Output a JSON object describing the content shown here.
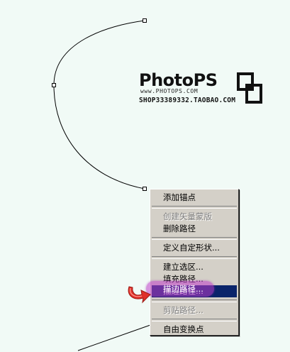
{
  "logo": {
    "brand": "PhotoPS",
    "url": "www.PHOTOPS.COM",
    "shop": "SHOP33389332.TAOBAO.COM"
  },
  "context_menu": {
    "items": [
      {
        "label": "添加锚点",
        "enabled": true
      },
      {
        "separator": true
      },
      {
        "label": "创建矢量蒙版",
        "enabled": false
      },
      {
        "label": "删除路径",
        "enabled": true
      },
      {
        "separator": true
      },
      {
        "label": "定义自定形状...",
        "enabled": true
      },
      {
        "separator": true
      },
      {
        "label": "建立选区...",
        "enabled": true
      },
      {
        "label": "填充路径...",
        "enabled": true
      },
      {
        "label": "描边路径...",
        "enabled": true,
        "highlighted": true
      },
      {
        "separator": true
      },
      {
        "label": "剪贴路径...",
        "enabled": false
      },
      {
        "separator": true
      },
      {
        "label": "自由变换点",
        "enabled": true
      }
    ]
  },
  "colors": {
    "canvas": "#f1faf6",
    "menu_bg": "#d4d0c8",
    "menu_highlight": "#0a246a",
    "marker": "#be3cc8",
    "arrow": "#e0302a"
  },
  "icons": {
    "pointer": "curved-arrow-icon",
    "logo_mark": "interlocked-squares-icon"
  }
}
